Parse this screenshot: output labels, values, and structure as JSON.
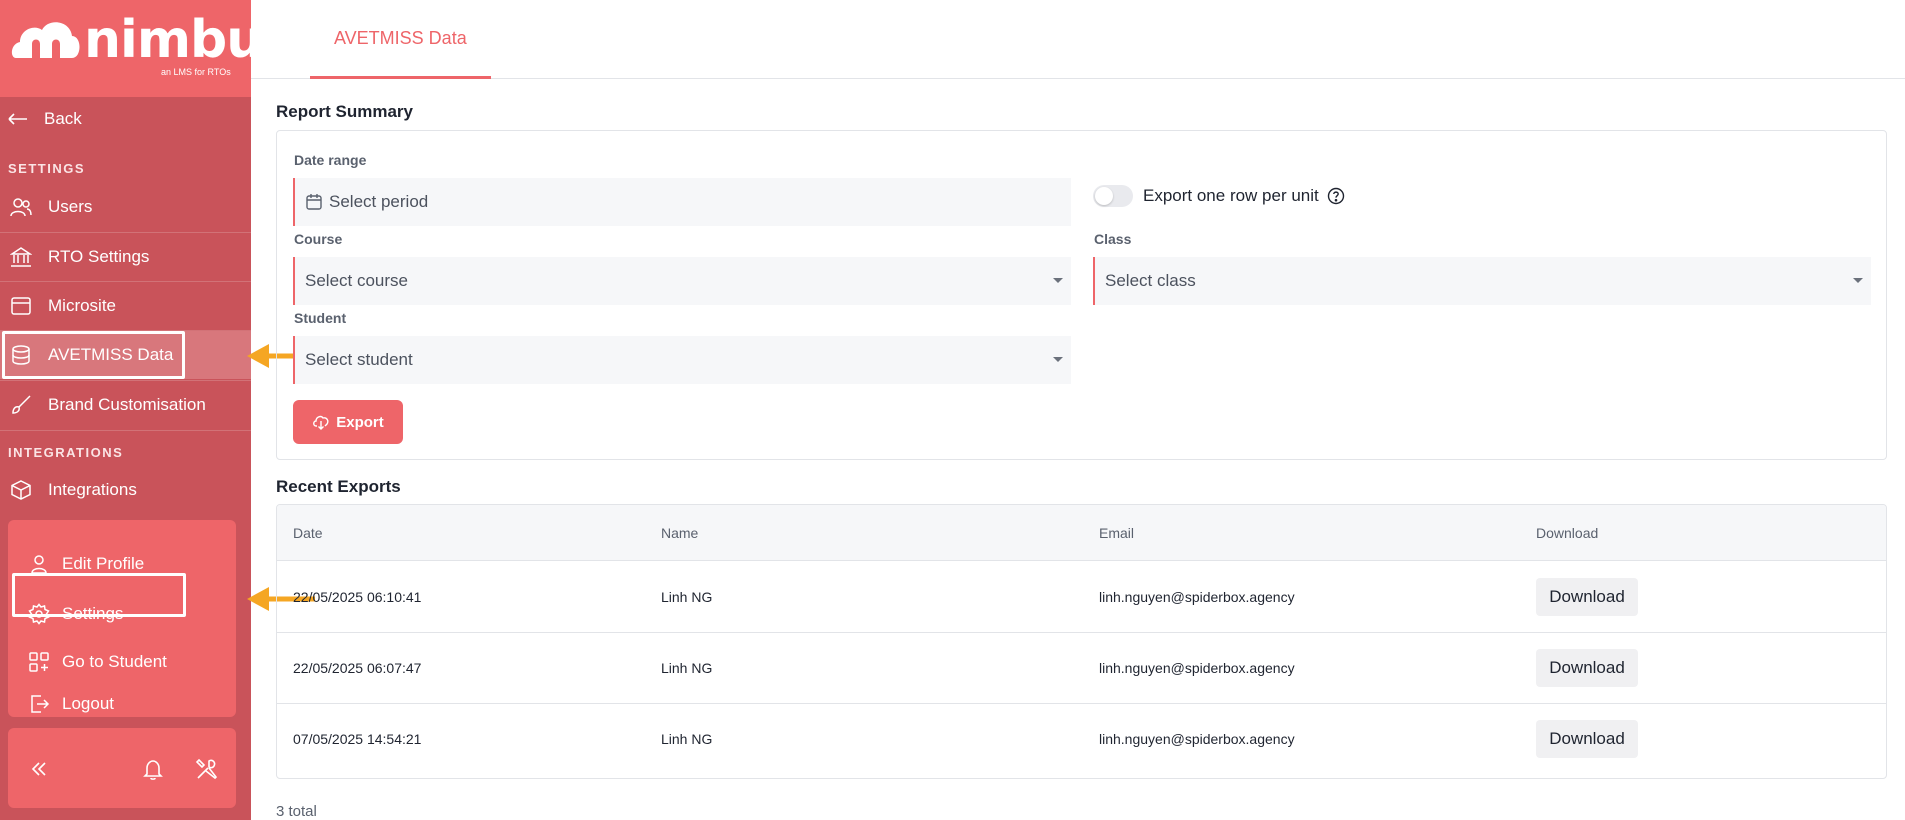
{
  "brand": {
    "name": "nimbu",
    "tagline": "an LMS for RTOs"
  },
  "sidebar": {
    "back_label": "Back",
    "settings_heading": "SETTINGS",
    "settings_items": [
      {
        "label": "Users",
        "icon": "users-icon"
      },
      {
        "label": "RTO Settings",
        "icon": "bank-icon"
      },
      {
        "label": "Microsite",
        "icon": "browser-window-icon"
      },
      {
        "label": "AVETMISS Data",
        "icon": "database-icon",
        "active": true
      },
      {
        "label": "Brand Customisation",
        "icon": "paintbrush-icon"
      }
    ],
    "integrations_heading": "INTEGRATIONS",
    "integrations_items": [
      {
        "label": "Integrations",
        "icon": "cube-icon"
      }
    ],
    "profile_menu": [
      {
        "label": "Edit Profile",
        "icon": "user-icon"
      },
      {
        "label": "Settings",
        "icon": "gear-icon"
      },
      {
        "label": "Go to Student",
        "icon": "grid-plus-icon"
      },
      {
        "label": "Logout",
        "icon": "logout-icon"
      }
    ],
    "bottom_icons": [
      "collapse-icon",
      "bell-icon",
      "tools-icon"
    ]
  },
  "main": {
    "tab_label": "AVETMISS Data",
    "report_summary": {
      "title": "Report Summary",
      "date_range_label": "Date range",
      "date_range_placeholder": "Select period",
      "export_toggle_label": "Export one row per unit",
      "course_label": "Course",
      "course_placeholder": "Select course",
      "class_label": "Class",
      "class_placeholder": "Select class",
      "student_label": "Student",
      "student_placeholder": "Select student",
      "export_button": "Export"
    },
    "recent_exports": {
      "title": "Recent Exports",
      "columns": [
        "Date",
        "Name",
        "Email",
        "Download"
      ],
      "rows": [
        {
          "date": "22/05/2025 06:10:41",
          "name": "Linh NG",
          "email": "linh.nguyen@spiderbox.agency",
          "download": "Download"
        },
        {
          "date": "22/05/2025 06:07:47",
          "name": "Linh NG",
          "email": "linh.nguyen@spiderbox.agency",
          "download": "Download"
        },
        {
          "date": "07/05/2025 14:54:21",
          "name": "Linh NG",
          "email": "linh.nguyen@spiderbox.agency",
          "download": "Download"
        }
      ],
      "total": "3 total"
    }
  },
  "colors": {
    "brand": "#ee6569",
    "sidebar": "#c9535a",
    "annotation_arrow": "#f5a623"
  }
}
